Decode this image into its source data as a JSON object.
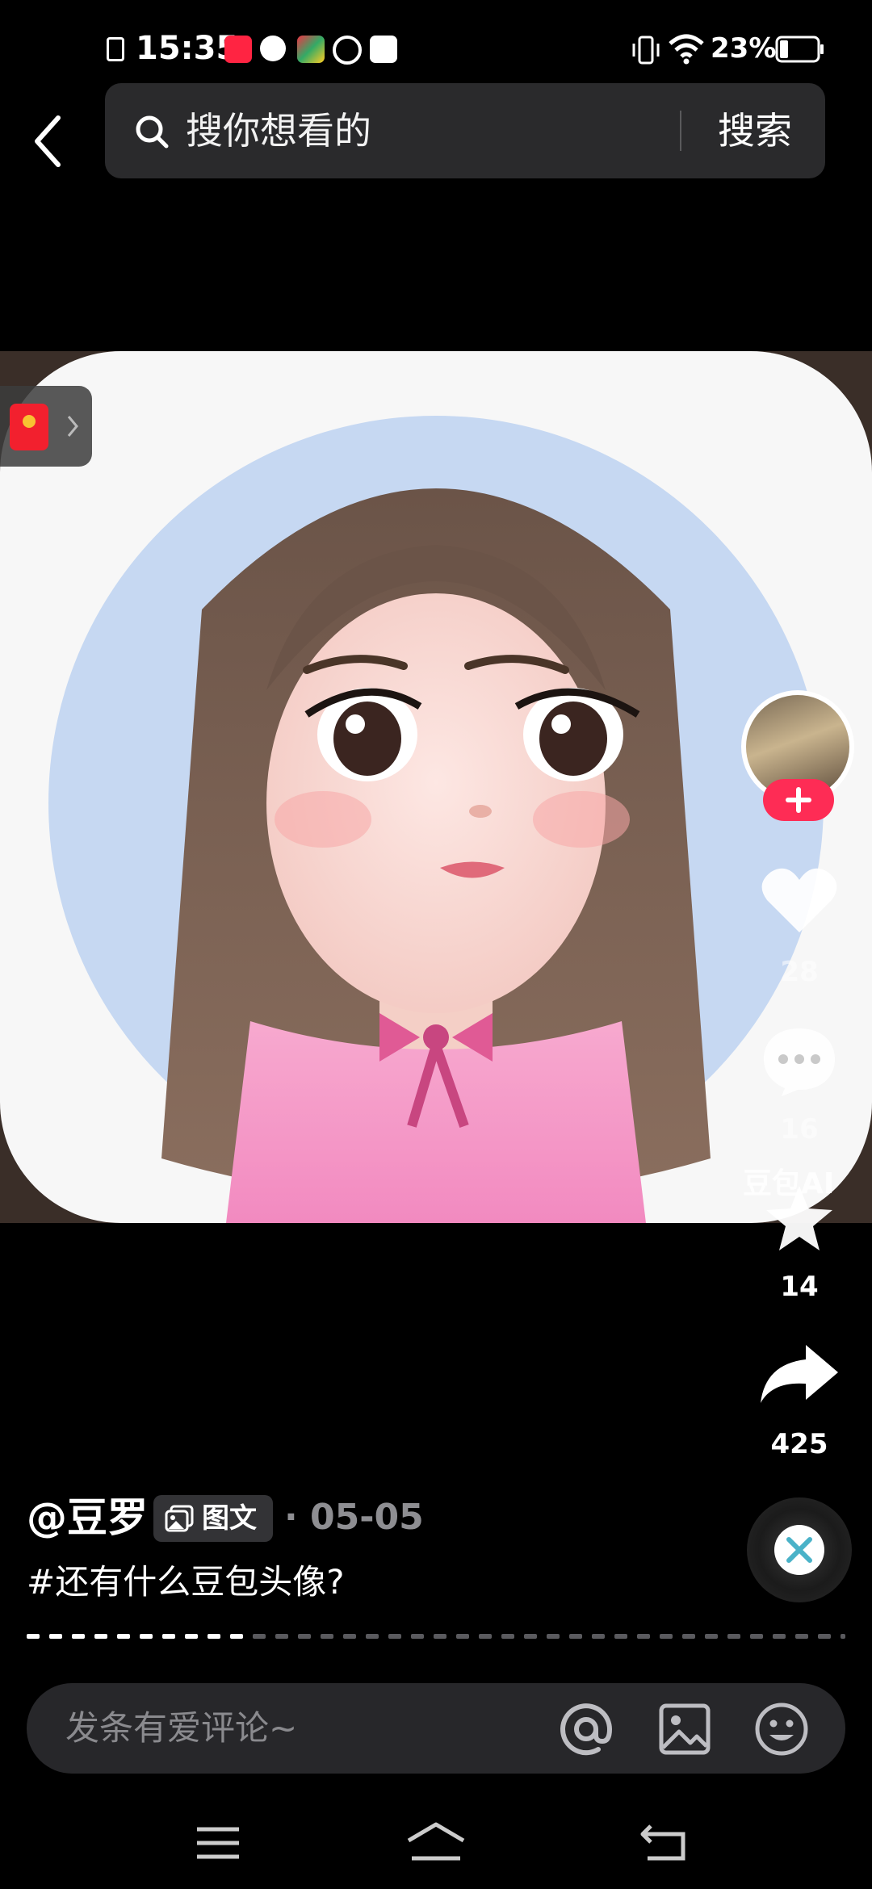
{
  "status_bar": {
    "time": "15:35",
    "battery_pct": "23%"
  },
  "search": {
    "placeholder": "搜你想看的",
    "button_label": "搜索"
  },
  "post": {
    "author": "@豆罗",
    "tag_label": "图文",
    "date": "· 05-05",
    "caption": "#还有什么豆包头像?",
    "watermark": "豆包AI",
    "progress": 0.25
  },
  "actions": {
    "like_count": "28",
    "comment_count": "16",
    "favorite_count": "14",
    "share_count": "425"
  },
  "comment_bar": {
    "placeholder": "发条有爱评论~"
  },
  "colors": {
    "accent": "#fe2c55",
    "background": "#000000",
    "search_bg": "#2a2a2c"
  }
}
